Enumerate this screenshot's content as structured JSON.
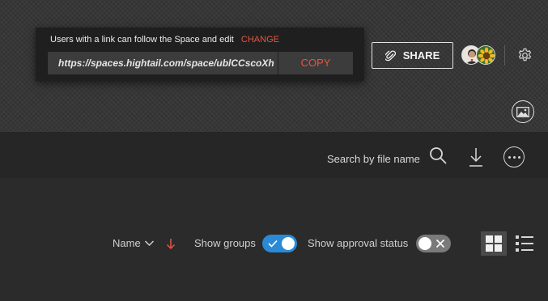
{
  "share_popover": {
    "description": "Users with a link can follow the Space and edit",
    "change_label": "CHANGE",
    "link_url": "https://spaces.hightail.com/space/ublCCscoXh",
    "copy_label": "COPY"
  },
  "header": {
    "share_label": "SHARE",
    "icons": [
      "link-icon",
      "avatar",
      "gear-icon",
      "image-icon"
    ]
  },
  "toolbar": {
    "search_label": "Search by file name",
    "icons": [
      "search-icon",
      "download-icon",
      "more-icon"
    ]
  },
  "filters": {
    "sort_label": "Name",
    "sort_direction": "descending",
    "show_groups_label": "Show groups",
    "show_groups_on": true,
    "show_approval_label": "Show approval status",
    "show_approval_on": false,
    "view_mode": "grid"
  },
  "colors": {
    "accent": "#e8553f",
    "toggle_on": "#2b8ad6",
    "toggle_off": "#7a7a7a",
    "background": "#2b2b2b"
  }
}
